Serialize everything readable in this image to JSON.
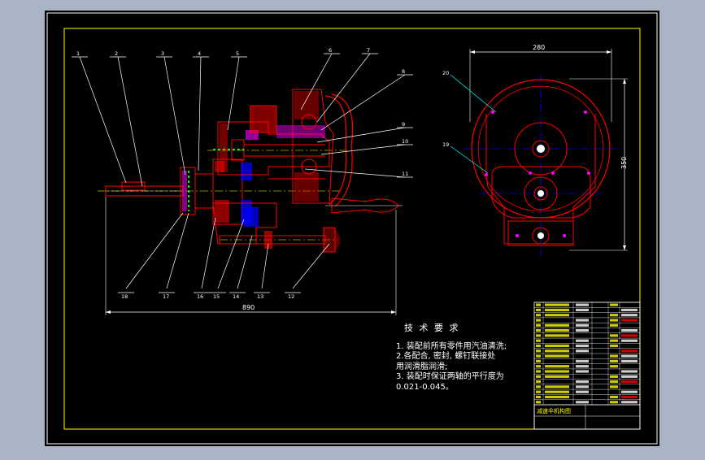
{
  "drawing": {
    "dims": {
      "overall_length": "890",
      "width": "280",
      "height": "350"
    },
    "callouts_top": [
      "1",
      "2",
      "3",
      "4",
      "5",
      "6",
      "7",
      "8",
      "9",
      "10",
      "11"
    ],
    "callouts_bottom": [
      "18",
      "17",
      "16",
      "15",
      "14",
      "13",
      "12"
    ],
    "callouts_side": [
      "20",
      "19"
    ],
    "colors": {
      "background": "#000000",
      "frame": "#ffffff",
      "border": "#ffff00",
      "outline": "#ff0000",
      "leader": "#ffffff",
      "dimension": "#00ffff",
      "centerline": "#0000ff",
      "hatch": "#ff00ff",
      "table_fill": "#ff0000"
    }
  },
  "tech_requirements": {
    "title": "技 术 要 求",
    "lines": [
      "1. 装配前所有零件用汽油清洗;",
      "2.各配合, 密封, 螺钉联接处",
      "用润滑脂润滑;",
      "3. 装配时保证两轴的平行度为",
      "0.021-0.045。"
    ]
  },
  "title_block": {
    "drawing_name": "减速伞机构图"
  }
}
